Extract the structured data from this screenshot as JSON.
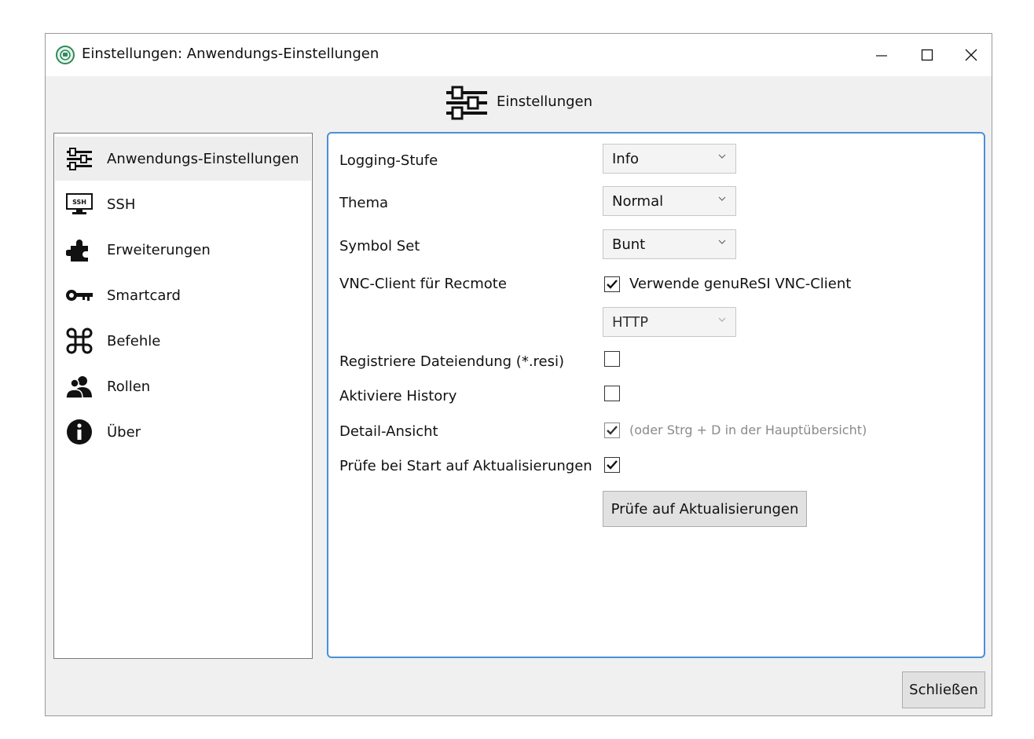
{
  "window": {
    "title": "Einstellungen: Anwendungs-Einstellungen",
    "controls": {
      "minimize_glyph": "—",
      "maximize_glyph": "☐",
      "close_glyph": "✕"
    }
  },
  "header": {
    "title": "Einstellungen",
    "icon": "sliders-icon"
  },
  "sidebar": {
    "items": [
      {
        "label": "Anwendungs-Einstellungen",
        "icon": "sliders-icon",
        "selected": true
      },
      {
        "label": "SSH",
        "icon": "ssh-monitor-icon",
        "selected": false
      },
      {
        "label": "Erweiterungen",
        "icon": "puzzle-icon",
        "selected": false
      },
      {
        "label": "Smartcard",
        "icon": "key-icon",
        "selected": false
      },
      {
        "label": "Befehle",
        "icon": "command-icon",
        "selected": false
      },
      {
        "label": "Rollen",
        "icon": "users-icon",
        "selected": false
      },
      {
        "label": "Über",
        "icon": "info-icon",
        "selected": false
      }
    ]
  },
  "settings": {
    "logging": {
      "label": "Logging-Stufe",
      "value": "Info"
    },
    "theme": {
      "label": "Thema",
      "value": "Normal"
    },
    "symbol_set": {
      "label": "Symbol Set",
      "value": "Bunt"
    },
    "vnc": {
      "label": "VNC-Client für Recmote",
      "checkbox_label": "Verwende genuReSI VNC-Client",
      "checked": true,
      "protocol_value": "HTTP"
    },
    "register_ext": {
      "label": "Registriere Dateiendung (*.resi)",
      "checked": false
    },
    "history": {
      "label": "Aktiviere History",
      "checked": false
    },
    "detail_view": {
      "label": "Detail-Ansicht",
      "checked": true,
      "hint": "(oder Strg + D in der Hauptübersicht)"
    },
    "check_updates_on_start": {
      "label": "Prüfe bei Start auf Aktualisierungen",
      "checked": true
    },
    "check_updates_button": "Prüfe auf Aktualisierungen"
  },
  "footer": {
    "close_button": "Schließen"
  },
  "colors": {
    "accent": "#4a90d9",
    "panel_bg": "#f0f0f0"
  }
}
